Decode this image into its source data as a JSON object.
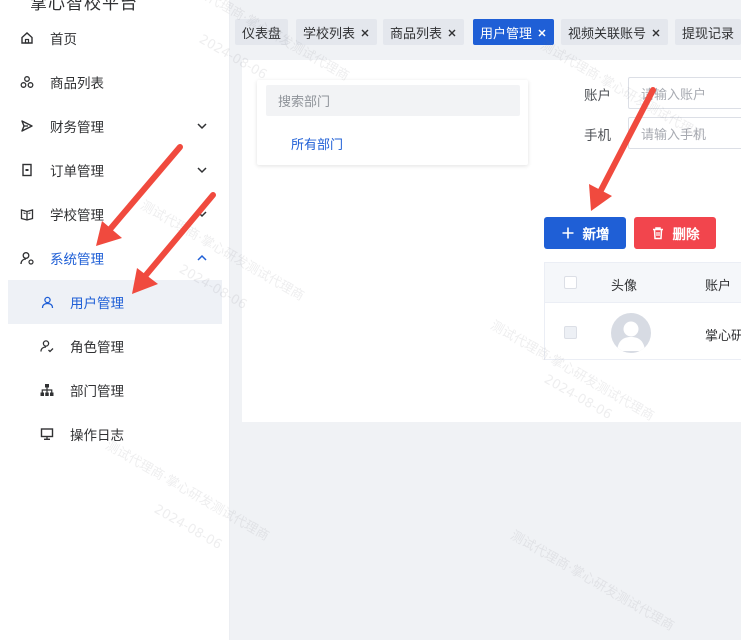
{
  "app": {
    "title": "掌心智校平台"
  },
  "sidebar": {
    "items": [
      {
        "label": "首页",
        "icon": "home-icon",
        "has_chevron": false
      },
      {
        "label": "商品列表",
        "icon": "goods-icon",
        "has_chevron": false
      },
      {
        "label": "财务管理",
        "icon": "send-icon",
        "has_chevron": true
      },
      {
        "label": "订单管理",
        "icon": "order-icon",
        "has_chevron": true
      },
      {
        "label": "学校管理",
        "icon": "book-icon",
        "has_chevron": true
      },
      {
        "label": "系统管理",
        "icon": "user-gear-icon",
        "has_chevron": true,
        "expanded": true
      }
    ],
    "submenu": [
      {
        "label": "用户管理",
        "icon": "user-icon",
        "selected": true
      },
      {
        "label": "角色管理",
        "icon": "role-icon",
        "selected": false
      },
      {
        "label": "部门管理",
        "icon": "tree-icon",
        "selected": false
      },
      {
        "label": "操作日志",
        "icon": "monitor-icon",
        "selected": false
      }
    ]
  },
  "tabs": [
    {
      "label": "仪表盘",
      "closable": false,
      "active": false
    },
    {
      "label": "学校列表",
      "closable": true,
      "active": false
    },
    {
      "label": "商品列表",
      "closable": true,
      "active": false
    },
    {
      "label": "用户管理",
      "closable": true,
      "active": true
    },
    {
      "label": "视频关联账号",
      "closable": true,
      "active": false
    },
    {
      "label": "提现记录",
      "closable": false,
      "active": false
    }
  ],
  "dept": {
    "search_placeholder": "搜索部门",
    "all_label": "所有部门"
  },
  "filters": {
    "account_label": "账户",
    "account_placeholder": "请输入账户",
    "phone_label": "手机",
    "phone_placeholder": "请输入手机"
  },
  "toolbar": {
    "add_label": "新增",
    "delete_label": "删除"
  },
  "table": {
    "headers": {
      "avatar": "头像",
      "account": "账户"
    },
    "rows": [
      {
        "account": "掌心研"
      }
    ]
  },
  "watermark": {
    "text1": "测试代理商·掌心研发测试代理商",
    "text2": "2024-08-06"
  },
  "colors": {
    "primary": "#1f5fd6",
    "danger": "#f2454d",
    "arrow": "#f04a3e"
  }
}
